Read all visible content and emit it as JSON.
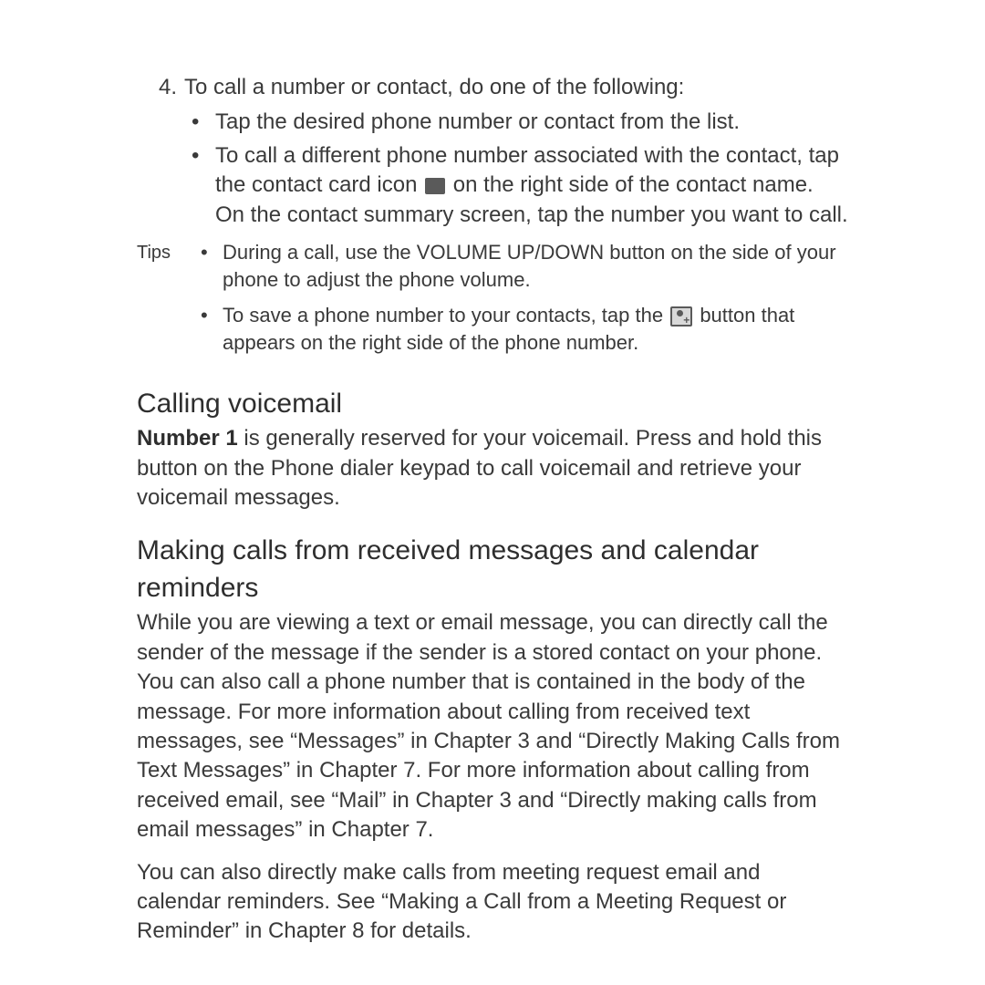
{
  "step": {
    "number": "4.",
    "text": "To call a number or contact, do one of the following:",
    "bullets": [
      "Tap the desired phone number or contact from the list.",
      {
        "before": "To call a different phone number associated with the contact, tap the contact card icon ",
        "after": " on the right side of the contact name. On the contact summary screen, tap the number you want to call."
      }
    ]
  },
  "tips": {
    "label": "Tips",
    "items": [
      "During a call, use the VOLUME UP/DOWN button on the side of your phone to adjust the phone volume.",
      {
        "before": "To save a phone number to your contacts, tap the ",
        "after": " button that appears on the right side of the phone number."
      }
    ]
  },
  "sections": {
    "voicemail": {
      "heading": "Calling voicemail",
      "bold_lead": "Number 1",
      "body_rest": " is generally reserved for your voicemail. Press and hold this button on the Phone dialer keypad to call voicemail and retrieve your voicemail messages."
    },
    "messages": {
      "heading": "Making calls from received messages and calendar reminders",
      "p1": "While you are viewing a text or email message, you can directly call the sender of the message if the sender is a stored contact on your phone. You can also call a phone number that is contained in the body of the message. For more information about calling from received text messages, see “Messages” in Chapter 3 and “Directly Making Calls from Text Messages” in Chapter 7. For more information about calling from received email, see “Mail” in Chapter 3 and “Directly making calls from email messages” in Chapter 7.",
      "p2": "You can also directly make calls from meeting request email and calendar reminders. See “Making a Call from a Meeting Request or Reminder” in Chapter 8 for details."
    }
  }
}
